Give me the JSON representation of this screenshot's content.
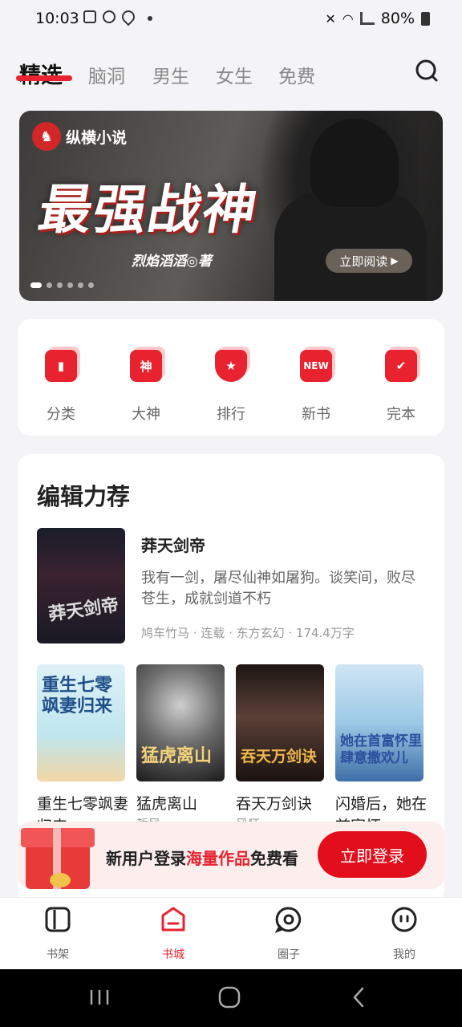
{
  "status": {
    "time": "10:03",
    "battery": "80%"
  },
  "tabs": [
    "精选",
    "脑洞",
    "男生",
    "女生",
    "免费"
  ],
  "banner": {
    "logo_text": "纵横小说",
    "title": "最强战神",
    "author": "烈焰滔滔◎著",
    "cta": "立即阅读"
  },
  "quick_links": [
    "分类",
    "大神",
    "排行",
    "新书",
    "完本"
  ],
  "quick_icon_text": {
    "god": "神",
    "new": "NEW"
  },
  "editor": {
    "title": "编辑力荐",
    "featured": {
      "name": "莽天剑帝",
      "desc": "我有一剑，屠尽仙神如屠狗。谈笑间，败尽苍生，成就剑道不朽",
      "meta": "鸠车竹马 · 连载 · 东方玄幻 · 174.4万字",
      "cover_text": "莽天剑帝"
    },
    "books": [
      {
        "name": "重生七零飒妻归来",
        "cover_text": "重生七零飒妻归来",
        "sub": "长安"
      },
      {
        "name": "猛虎离山",
        "cover_text": "猛虎离山",
        "sub": "哲风"
      },
      {
        "name": "吞天万剑诀",
        "cover_text": "吞天万剑诀",
        "sub": "风狂"
      },
      {
        "name": "闪婚后，她在首富怀",
        "cover_text": "她在首富怀里肆意撒欢儿",
        "sub": ""
      }
    ]
  },
  "promo": {
    "pre": "新用户登录",
    "highlight": "海量作品",
    "post": "免费看",
    "button": "立即登录"
  },
  "bottom_nav": [
    "书架",
    "书城",
    "圈子",
    "我的"
  ],
  "colors": {
    "accent": "#e8222e"
  }
}
